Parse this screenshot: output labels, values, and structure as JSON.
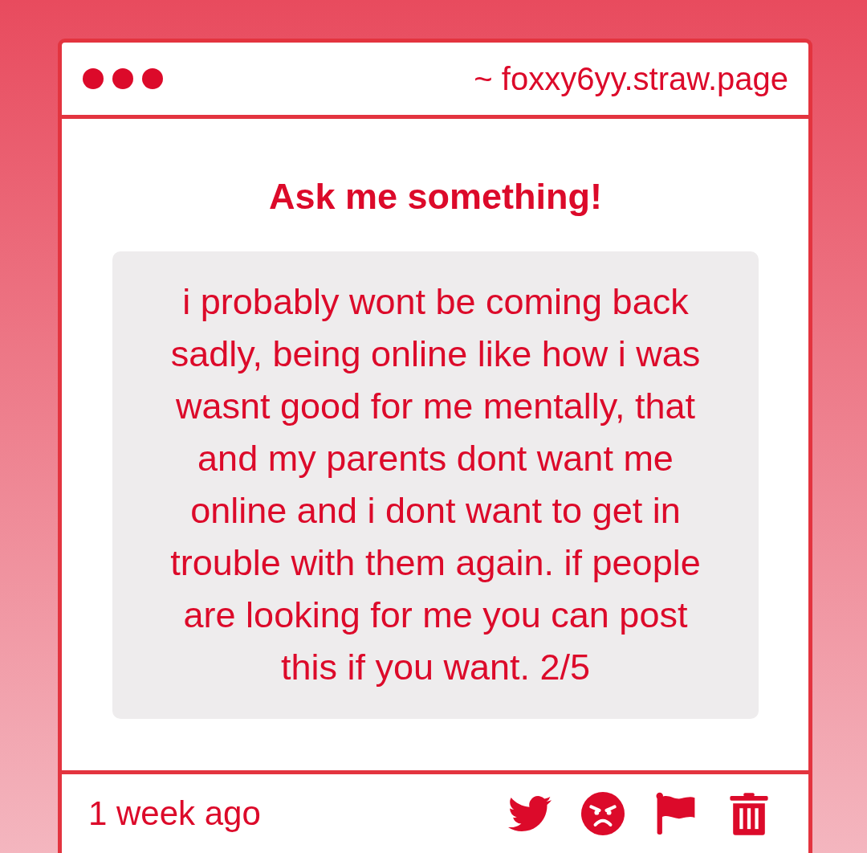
{
  "address_bar": {
    "url": "~ foxxy6yy.straw.page"
  },
  "heading": "Ask me something!",
  "question": {
    "text": "i probably wont be coming back sadly, being online like how i was wasnt good for me mentally, that and my parents dont want me online and i dont want to get in trouble with them again. if people are looking for me you can post this if you want. 2/5"
  },
  "footer": {
    "time": "1 week ago",
    "actions": [
      {
        "kind": "share"
      },
      {
        "kind": "react"
      },
      {
        "kind": "report"
      },
      {
        "kind": "delete"
      }
    ]
  }
}
